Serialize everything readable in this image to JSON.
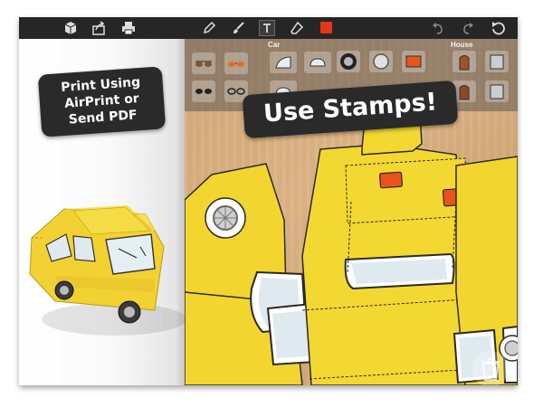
{
  "toolbar": {
    "left_tools": [
      "cube-icon",
      "share-icon",
      "printer-icon"
    ],
    "drawing_tools": [
      "pencil-icon",
      "brush-icon",
      "text-tool-icon",
      "eraser-icon"
    ],
    "current_color": "#e8341a",
    "history_tools": [
      "undo-icon",
      "redo-icon",
      "reset-icon"
    ]
  },
  "callouts": {
    "print": [
      "Print Using",
      "AirPrint or",
      "Send PDF"
    ],
    "stamps": "Use Stamps!"
  },
  "stamps": {
    "categories": [
      "Car",
      "House"
    ],
    "car_stamps": [
      "sunglasses-icon",
      "glasses-icon",
      "windshield-icon",
      "window-icon",
      "wheel-icon",
      "headlight-icon",
      "orange-light-icon"
    ],
    "house_stamps": [
      "door-icon",
      "window-icon"
    ]
  },
  "colors": {
    "toolbar": "#262626",
    "car_yellow": "#f5d938",
    "light_orange": "#e8541a",
    "wood": "#d4a877",
    "callout_bg": "#2a2a2a"
  }
}
